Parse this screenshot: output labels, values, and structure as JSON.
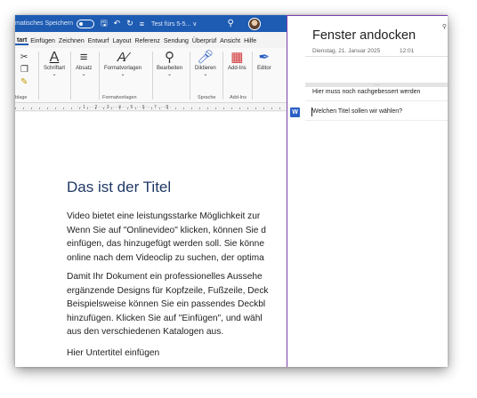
{
  "word": {
    "titlebar": {
      "autosave_label": "matisches Speichern",
      "doc_name": "Test fürs 5-5... ∨",
      "save_icon": "save-icon",
      "undo_icon": "undo-icon",
      "redo_icon": "redo-icon",
      "search_icon": "search-icon"
    },
    "tabs": [
      "tart",
      "Einfügen",
      "Zeichnen",
      "Entwurf",
      "Layout",
      "Referenz",
      "Sendung",
      "Überprüf",
      "Ansicht",
      "Hilfe"
    ],
    "ribbon": {
      "clipboard_label": "blage",
      "font_label": "Schriftart",
      "paragraph_label": "Absatz",
      "styles_label": "Formatvorlagen",
      "styles_group_label": "Formatvorlagen",
      "edit_label": "Bearbeiten",
      "dictate_label": "Diktieren",
      "speech_group_label": "Sprache",
      "addins_label": "Add-Ins",
      "addins_group_label": "Add-Ins",
      "editor_label": "Editor"
    },
    "ruler_text": "· · 1 · · · 2 · · · 3 · · · 4 · · · 5 · · · 6 · · · 7 · · · 8 ·",
    "document": {
      "title": "Das ist der Titel",
      "para1": [
        "Video bietet eine leistungsstarke Möglichkeit zur",
        "Wenn Sie auf \"Onlinevideo\" klicken, können Sie d",
        "einfügen, das hinzugefügt werden soll. Sie könne",
        "online nach dem Videoclip zu suchen, der optima"
      ],
      "para2": [
        "Damit Ihr Dokument ein professionelles Aussehe",
        "ergänzende Designs für Kopfzeile, Fußzeile, Deck",
        "Beispielsweise können Sie ein passendes Deckbl",
        "hinzufügen. Klicken Sie auf \"Einfügen\", und wähl",
        "aus den verschiedenen Katalogen aus."
      ],
      "subtitle": "Hier Untertitel einfügen"
    }
  },
  "onenote": {
    "title": "Fenster andocken",
    "date": "Dienstag, 21. Januar 2025",
    "time": "12:01",
    "handle": "....",
    "note1": "Hier muss noch nachgebessert werden",
    "note2": "Welchen Titel sollen wir wählen?",
    "word_link_icon": "W"
  },
  "colors": {
    "word_blue": "#1e5cb3",
    "onenote_purple": "#7b3fb0",
    "title_navy": "#1f3864"
  }
}
